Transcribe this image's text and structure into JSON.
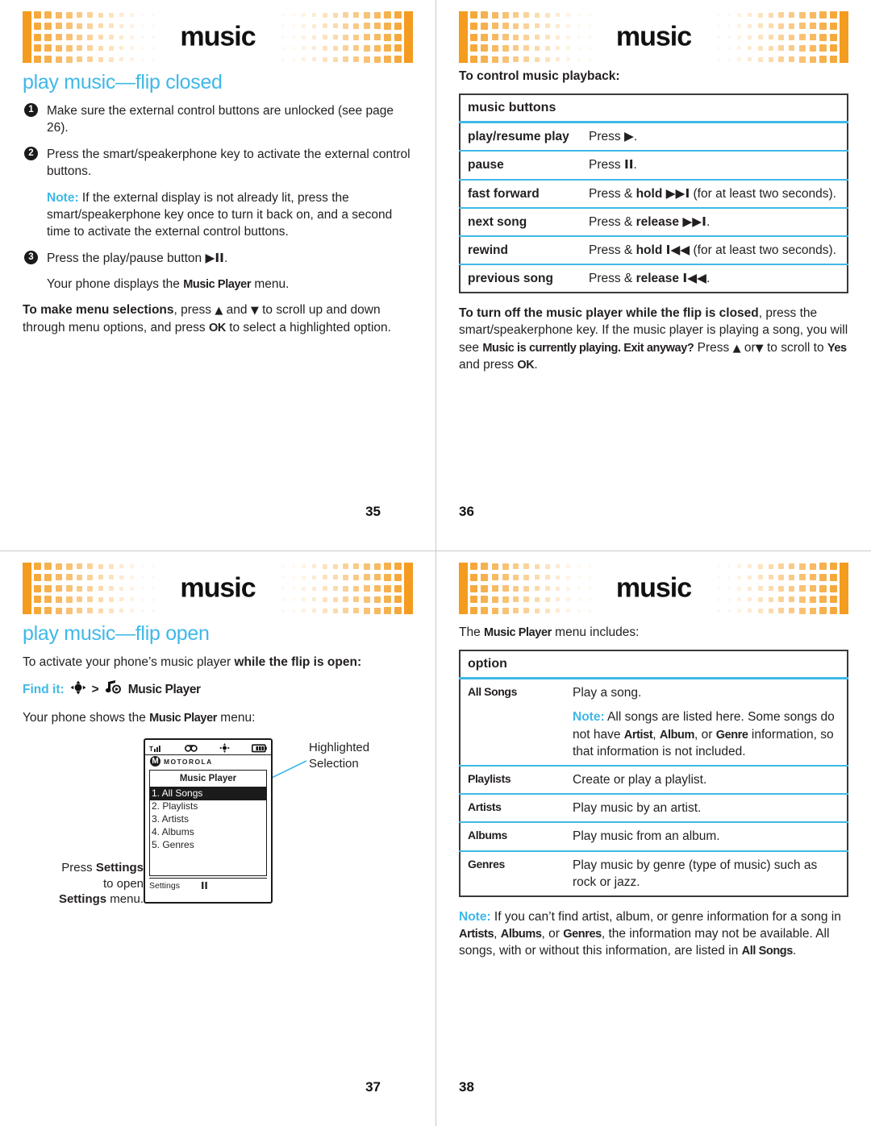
{
  "colors": {
    "accent_cyan": "#3fb8e8",
    "orange": "#f39c20",
    "orange_light": "#f5a93c",
    "ink": "#231f20"
  },
  "banner": {
    "title": "music"
  },
  "pages": [
    {
      "number": "35",
      "heading": "play music—flip closed",
      "steps": [
        {
          "num": "❶",
          "text_a": "Make sure the external control buttons are unlocked (see page 26)."
        },
        {
          "num": "❷",
          "text_a": "Press the smart/speakerphone key to activate the external control buttons."
        },
        {
          "num": "❸",
          "text_a": "Press the play/pause button ",
          "sym": "▶II",
          "text_b": "."
        }
      ],
      "note_label": "Note:",
      "note_body": " If the external display is not already lit, press the smart/speakerphone key once to turn it back on, and a second time to activate the external control buttons.",
      "displays_pre": "Your phone displays the ",
      "displays_ui": "Music Player",
      "displays_post": " menu.",
      "selections_lead": "To make menu selections",
      "selections_a": ", press ",
      "selections_up": "▲",
      "selections_b": " and ",
      "selections_down": "▼",
      "selections_c": " to scroll up and down through menu options, and press ",
      "selections_ok": "OK",
      "selections_d": " to select a highlighted option."
    },
    {
      "number": "36",
      "intro": "To control music playback:",
      "table": {
        "header": "music buttons",
        "rows": [
          {
            "key": "play/resume play",
            "press": "Press ",
            "sym": "▶",
            "tail": "."
          },
          {
            "key": "pause",
            "press": "Press ",
            "sym": "II",
            "tail": "."
          },
          {
            "key": "fast forward",
            "press": "Press & ",
            "bold": "hold",
            "mid": " ",
            "sym": "▶▶I",
            "tail": " (for at least two seconds)."
          },
          {
            "key": "next song",
            "press": "Press & ",
            "bold": "release",
            "mid": " ",
            "sym": "▶▶I",
            "tail": "."
          },
          {
            "key": "rewind",
            "press": "Press & ",
            "bold": "hold",
            "mid": " ",
            "sym": "I◀◀",
            "tail": " (for at least two seconds)."
          },
          {
            "key": "previous song",
            "press": "Press & ",
            "bold": "release",
            "mid": " ",
            "sym": "I◀◀",
            "tail": "."
          }
        ]
      },
      "turnoff_lead": "To turn off the music player while the flip is closed",
      "turnoff_a": ", press the smart/speakerphone key. If the music player is playing a song, you will see ",
      "turnoff_ui": "Music is currently playing. Exit anyway?",
      "turnoff_b": " Press ",
      "turnoff_up": "▲",
      "turnoff_c": " or",
      "turnoff_down": "▼",
      "turnoff_d": " to scroll to ",
      "turnoff_yes": "Yes",
      "turnoff_e": " and press ",
      "turnoff_ok": "OK",
      "turnoff_f": "."
    },
    {
      "number": "37",
      "heading": "play music—flip open",
      "activate_a": "To activate your phone’s music player ",
      "activate_bold": "while the flip is open",
      "activate_b": ":",
      "finditlabel": "Find it:",
      "findit_nav_icon": "nav-key-icon",
      "findit_sep": ">",
      "findit_player_icon": "music-player-icon",
      "findit_target": "Music Player",
      "shows_pre": "Your phone shows the ",
      "shows_ui": "Music Player",
      "shows_post": " menu:",
      "phone": {
        "brand": "MOTOROLA",
        "screen_title": "Music Player",
        "menu": [
          "1. All Songs",
          "2. Playlists",
          "3. Artists",
          "4. Albums",
          "5. Genres"
        ],
        "highlighted_index": 0,
        "softkey_left": "Settings",
        "softkey_right": "II",
        "status_icons": [
          "signal-icon",
          "voicemail-icon",
          "location-icon",
          "battery-icon"
        ]
      },
      "callout_highlight": "Highlighted\nSelection",
      "callout_settings_a": "Press ",
      "callout_settings_bold1": "Settings",
      "callout_settings_b": " to open ",
      "callout_settings_bold2": "Settings",
      "callout_settings_c": " menu."
    },
    {
      "number": "38",
      "intro_pre": "The ",
      "intro_ui": "Music Player",
      "intro_post": " menu includes:",
      "table": {
        "header": "option",
        "rows": [
          {
            "key": "All Songs",
            "desc": "Play a song.",
            "note_label": "Note:",
            "note_a": " All songs are listed here. Some songs do not have ",
            "note_ui1": "Artist",
            "note_b": ", ",
            "note_ui2": "Album",
            "note_c": ", or ",
            "note_ui3": "Genre",
            "note_d": " information, so that information is not included."
          },
          {
            "key": "Playlists",
            "desc": "Create or play a playlist."
          },
          {
            "key": "Artists",
            "desc": "Play music by an artist."
          },
          {
            "key": "Albums",
            "desc": "Play music from an album."
          },
          {
            "key": "Genres",
            "desc": "Play music by genre (type of music) such as rock or jazz."
          }
        ]
      },
      "note_label": "Note:",
      "note_a": " If you can’t find artist, album, or genre information for a song in ",
      "note_ui1": "Artists",
      "note_b": ", ",
      "note_ui2": "Albums",
      "note_c": ", or ",
      "note_ui3": "Genres",
      "note_d": ", the information may not be available. All songs, with or without this information, are listed in ",
      "note_ui4": "All Songs",
      "note_e": "."
    }
  ]
}
